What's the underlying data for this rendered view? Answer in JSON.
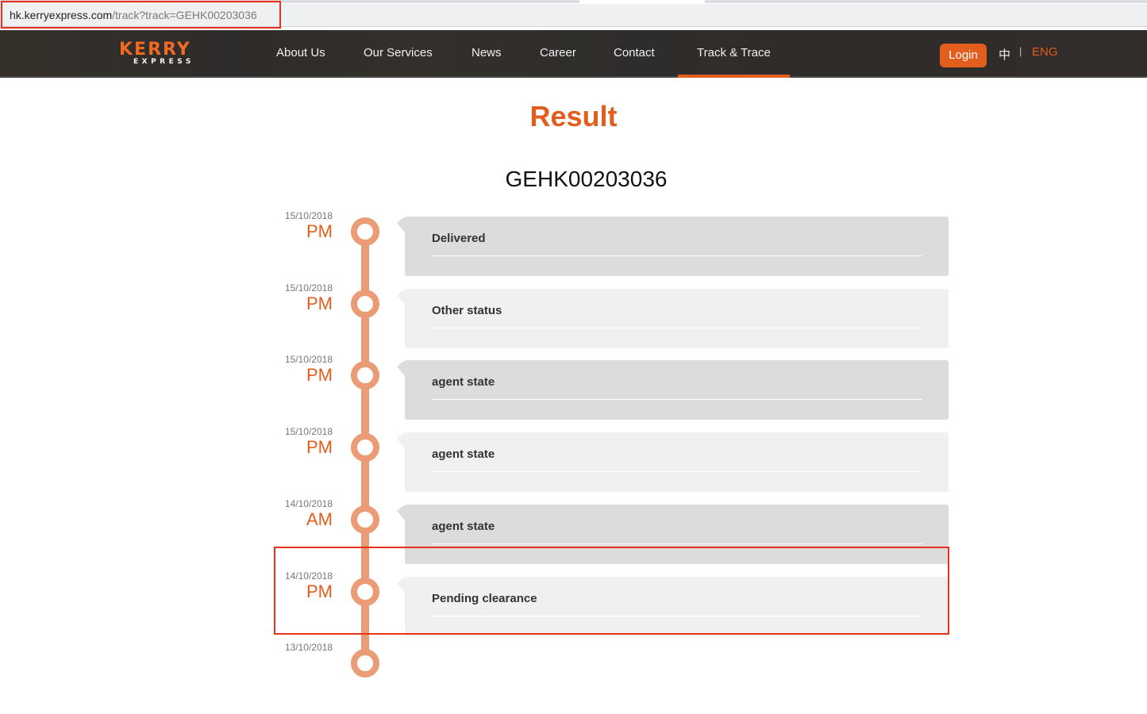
{
  "browser": {
    "url_host": "hk.kerryexpress.com",
    "url_path": "/track?track=GEHK00203036"
  },
  "header": {
    "logo_main": "KERRY",
    "logo_sub": "EXPRESS",
    "nav": [
      {
        "label": "About Us",
        "active": false
      },
      {
        "label": "Our Services",
        "active": false
      },
      {
        "label": "News",
        "active": false
      },
      {
        "label": "Career",
        "active": false
      },
      {
        "label": "Contact",
        "active": false
      },
      {
        "label": "Track & Trace",
        "active": true
      }
    ],
    "login_label": "Login",
    "lang_zh": "中",
    "lang_sep": "|",
    "lang_en": "ENG"
  },
  "colors": {
    "brand_orange": "#e35d1c",
    "timeline": "#eb9b75",
    "card_dark": "#dcdcdc",
    "card_light": "#f0f0f0"
  },
  "result": {
    "title": "Result",
    "tracking_number": "GEHK00203036"
  },
  "timeline": [
    {
      "date": "15/10/2018",
      "ampm": "PM",
      "status": "Delivered"
    },
    {
      "date": "15/10/2018",
      "ampm": "PM",
      "status": "Other status"
    },
    {
      "date": "15/10/2018",
      "ampm": "PM",
      "status": "agent state"
    },
    {
      "date": "15/10/2018",
      "ampm": "PM",
      "status": "agent state"
    },
    {
      "date": "14/10/2018",
      "ampm": "AM",
      "status": "agent state"
    },
    {
      "date": "14/10/2018",
      "ampm": "PM",
      "status": "Pending clearance"
    },
    {
      "date": "13/10/2018",
      "ampm": "",
      "status": ""
    }
  ]
}
